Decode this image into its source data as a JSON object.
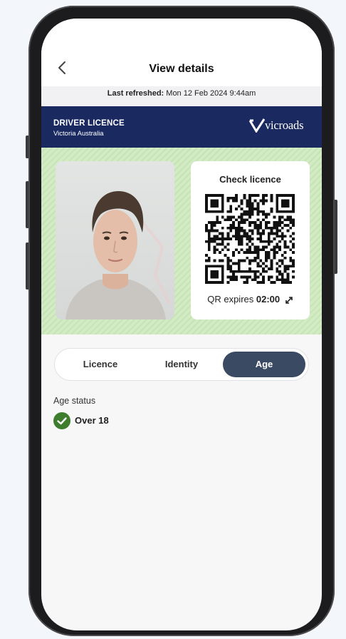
{
  "header": {
    "title": "View details",
    "back_icon": "chevron-left-icon"
  },
  "refresh": {
    "label": "Last refreshed:",
    "value": " Mon 12 Feb 2024 9:44am"
  },
  "licence": {
    "title": "DRIVER LICENCE",
    "subtitle": "Victoria Australia",
    "brand": "vicroads",
    "band_color": "#1a2a60"
  },
  "qr": {
    "title": "Check licence",
    "expires_label": "QR expires ",
    "expires_value": "02:00",
    "expand_icon": "expand-diagonal-icon"
  },
  "tabs": [
    {
      "label": "Licence",
      "active": false
    },
    {
      "label": "Identity",
      "active": false
    },
    {
      "label": "Age",
      "active": true
    }
  ],
  "age": {
    "label": "Age status",
    "value": "Over 18",
    "check_color": "#3f7d2e"
  },
  "colors": {
    "active_tab": "#3b4a63",
    "card_green": "#d2ebc3"
  }
}
